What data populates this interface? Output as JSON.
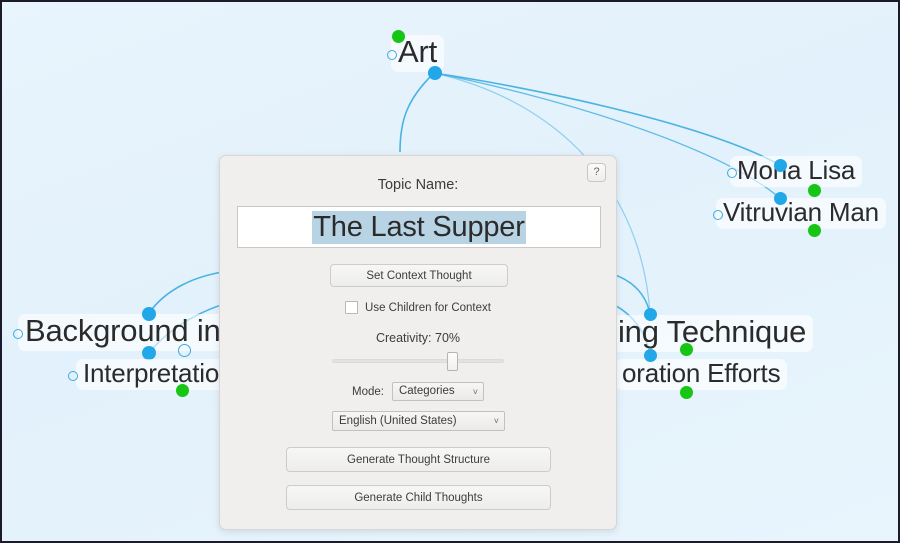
{
  "canvas": {
    "background_color": "#e5f1fb",
    "link_color": "#4ab3e3",
    "node_dot_blue": "#22a7e8",
    "node_dot_green": "#17c514",
    "nodes": [
      {
        "id": "art",
        "label": "Art"
      },
      {
        "id": "mona-lisa",
        "label": "Mona Lisa"
      },
      {
        "id": "vitruvian-man",
        "label": "Vitruvian Man"
      },
      {
        "id": "background-info",
        "label": "Background info"
      },
      {
        "id": "interpretation",
        "label": "Interpretation"
      },
      {
        "id": "painting-technique",
        "label": "ing Technique"
      },
      {
        "id": "restoration-efforts",
        "label": "oration Efforts"
      }
    ]
  },
  "dialog": {
    "help_label": "?",
    "topic_label": "Topic Name:",
    "topic_value": "The Last Supper",
    "set_context_label": "Set Context Thought",
    "use_children_label": "Use Children for Context",
    "creativity_label": "Creativity: 70%",
    "creativity_percent": 70,
    "mode_label": "Mode:",
    "mode_value": "Categories",
    "language_value": "English (United States)",
    "caret_glyph": "˅",
    "generate_structure_label": "Generate Thought Structure",
    "generate_children_label": "Generate Child Thoughts"
  }
}
